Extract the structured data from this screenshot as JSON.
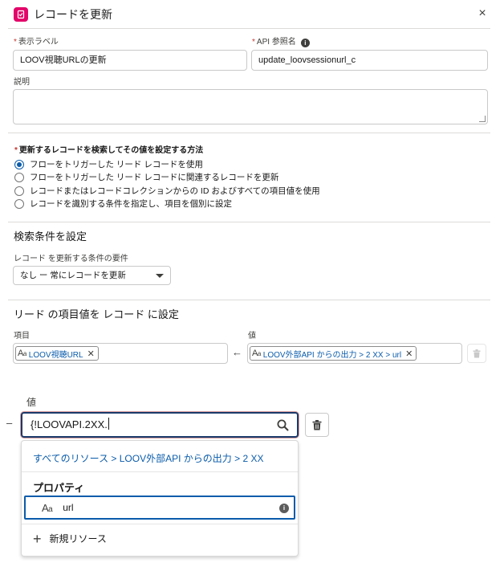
{
  "header": {
    "title": "レコードを更新",
    "close_glyph": "×"
  },
  "form": {
    "label_field": {
      "label": "表示ラベル",
      "value": "LOOV視聴URLの更新"
    },
    "api_field": {
      "label": "API 参照名",
      "value": "update_loovsessionurl_c"
    },
    "description": {
      "label": "説明",
      "value": ""
    }
  },
  "method": {
    "label": "更新するレコードを検索してその値を設定する方法",
    "options": [
      "フローをトリガーした リード レコードを使用",
      "フローをトリガーした リード レコードに関連するレコードを更新",
      "レコードまたはレコードコレクションからの ID およびすべての項目値を使用",
      "レコードを識別する条件を指定し、項目を個別に設定"
    ],
    "selected_index": 0
  },
  "criteria": {
    "title": "検索条件を設定",
    "requirement_label": "レコード を更新する条件の要件",
    "requirement_value": "なし ー 常にレコードを更新"
  },
  "assignment": {
    "title": "リード の項目値を レコード に設定",
    "field_label": "項目",
    "value_label": "値",
    "field_pill": "LOOV視聴URL",
    "value_pill": "LOOV外部API からの出力 > 2 XX > url",
    "arrow": "←"
  },
  "zoom": {
    "value_label": "値",
    "dash": "–",
    "search_value": "{!LOOVAPI.2XX.",
    "breadcrumb": "すべてのリソース > LOOV外部API からの出力 > 2 XX",
    "section_title": "プロパティ",
    "option_label": "url",
    "new_resource": "新規リソース"
  },
  "icons": {
    "header": "flow-update-icon",
    "close": "close-icon",
    "info": "info-icon",
    "dropdown": "chevron-down-icon",
    "delete": "trash-icon",
    "search": "search-icon",
    "text_type": "text-type-icon",
    "add": "plus-icon"
  },
  "colors": {
    "brand_pink": "#e3066a",
    "link_blue": "#0b5cab",
    "focus_border": "#1b3a6b",
    "required_red": "#c23934"
  }
}
